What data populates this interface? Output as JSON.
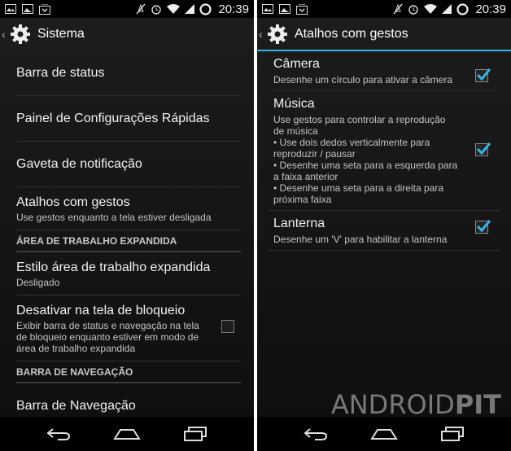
{
  "status_bar": {
    "time": "20:39"
  },
  "left": {
    "title": "Sistema",
    "items": [
      {
        "title": "Barra de status"
      },
      {
        "title": "Painel de Configurações Rápidas"
      },
      {
        "title": "Gaveta de notificação"
      },
      {
        "title": "Atalhos com gestos",
        "summary": "Use gestos enquanto a tela estiver desligada"
      }
    ],
    "section_expanded": "ÁREA DE TRABALHO EXPANDIDA",
    "expanded_items": [
      {
        "title": "Estilo área de trabalho expandida",
        "summary": "Desligado"
      },
      {
        "title": "Desativar na tela de bloqueio",
        "summary": "Exibir barra de status e navegação na tela de bloqueio enquanto estiver em modo de área de trabalho expandida",
        "checked": false
      }
    ],
    "section_nav": "BARRA DE NAVEGAÇÃO",
    "nav_items": [
      {
        "title": "Barra de Navegação"
      }
    ]
  },
  "right": {
    "title": "Atalhos com gestos",
    "items": [
      {
        "title": "Câmera",
        "summary": "Desenhe um círculo para ativar a câmera",
        "checked": true
      },
      {
        "title": "Música",
        "summary": "Use gestos para controlar a reprodução de música\n• Use dois dedos verticalmente para reproduzir / pausar\n• Desenhe uma seta para a esquerda para a faixa anterior\n• Desenhe uma seta para a direita para próxima faixa",
        "checked": true
      },
      {
        "title": "Lanterna",
        "summary": "Desenhe um 'V' para habilitar a lanterna",
        "checked": true
      }
    ]
  },
  "watermark": {
    "part1": "ANDROID",
    "part2": "PIT"
  },
  "icons": {
    "status_left": [
      "gallery-icon",
      "image-icon",
      "download-box-icon"
    ],
    "status_right": [
      "mute-icon",
      "alarm-icon",
      "wifi-icon",
      "signal-icon",
      "battery-icon"
    ],
    "nav": [
      "back-icon",
      "home-icon",
      "recents-icon"
    ]
  },
  "colors": {
    "accent": "#33b5e5",
    "check": "#33b5e5"
  }
}
